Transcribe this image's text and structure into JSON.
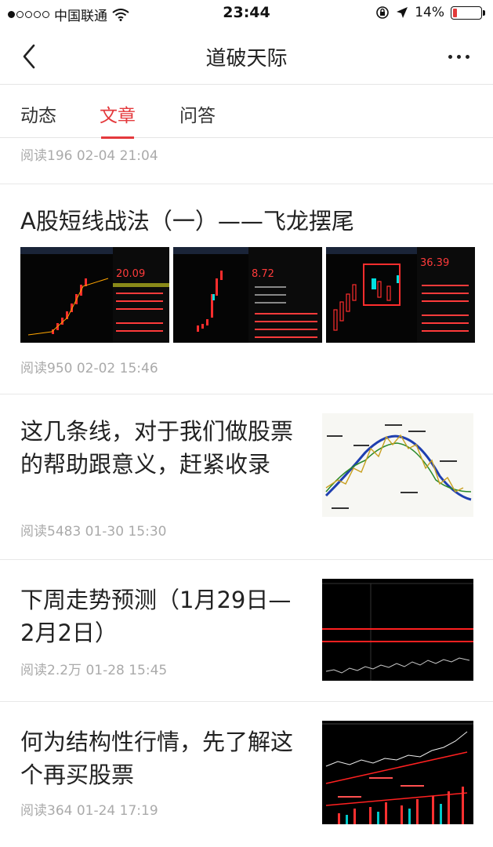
{
  "status_bar": {
    "carrier": "中国联通",
    "time": "23:44",
    "battery": "14%",
    "battery_level": 0.14
  },
  "nav": {
    "title": "道破天际"
  },
  "tabs": [
    {
      "label": "动态",
      "active": false
    },
    {
      "label": "文章",
      "active": true
    },
    {
      "label": "问答",
      "active": false
    }
  ],
  "articles": [
    {
      "title": "",
      "meta": "阅读196   02-04 21:04"
    },
    {
      "title": "A股短线战法（一）——飞龙摆尾",
      "meta": "阅读950   02-02 15:46"
    },
    {
      "title": "这几条线，对于我们做股票的帮助跟意义，赶紧收录",
      "meta": "阅读5483   01-30 15:30"
    },
    {
      "title": "下周走势预测（1月29日—2月2日）",
      "meta": "阅读2.2万   01-28 15:45"
    },
    {
      "title": "何为结构性行情，先了解这个再买股票",
      "meta": "阅读364   01-24 17:19"
    }
  ],
  "thumb_labels": {
    "a": "20.09",
    "b": "8.72",
    "c": "36.39"
  },
  "colors": {
    "accent": "#e4393c",
    "meta_text": "#aaaaaa"
  }
}
